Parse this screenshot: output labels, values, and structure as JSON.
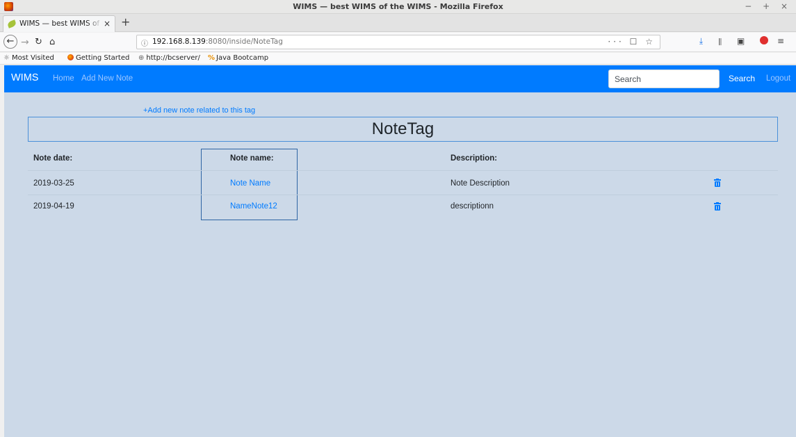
{
  "window": {
    "title": "WIMS — best WIMS of the WIMS - Mozilla Firefox",
    "controls": "− + ×"
  },
  "tab": {
    "label": "WIMS — best WIMS of the WIMS",
    "close": "×",
    "new_tab": "+"
  },
  "nav": {
    "back": "←",
    "forward": "→",
    "reload": "↻",
    "home": "⌂"
  },
  "url": {
    "info": "ⓘ",
    "host": "192.168.8.139",
    "rest": ":8080/inside/NoteTag",
    "actions": "··· ☐ ☆"
  },
  "toolbar_icons": {
    "download": "⤓",
    "library": "⫴",
    "sidebar": "▣",
    "menu": "≡"
  },
  "bookmarks": [
    {
      "label": "Most Visited",
      "glyph": "☼"
    },
    {
      "label": "Getting Started"
    },
    {
      "label": "http://bcserver/",
      "glyph": "⊕"
    },
    {
      "label": "Java Bootcamp",
      "glyph": "%"
    }
  ],
  "app": {
    "brand": "WIMS",
    "links": [
      "Home",
      "Add New Note"
    ],
    "search_placeholder": "Search",
    "search_button": "Search",
    "logout": "Logout",
    "accent": "#007bff"
  },
  "page": {
    "add_link": "+Add new note related to this tag",
    "title": "NoteTag"
  },
  "table": {
    "headers": [
      "Note date:",
      "Note name:",
      "Description:"
    ],
    "rows": [
      {
        "date": "2019-03-25",
        "name": "Note Name",
        "description": "Note Description"
      },
      {
        "date": "2019-04-19",
        "name": "NameNote12",
        "description": "descriptionn"
      }
    ]
  }
}
